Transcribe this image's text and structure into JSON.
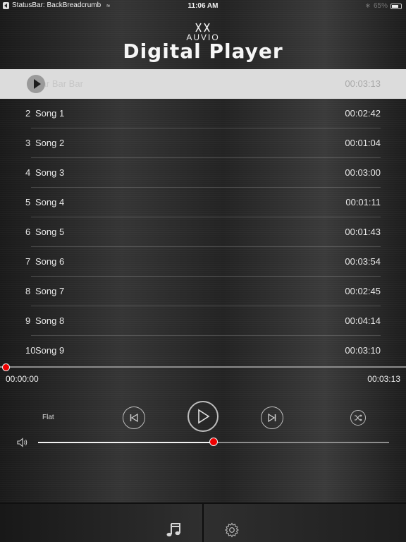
{
  "status_bar": {
    "back_label": "StatusBar: BackBreadcrumb",
    "time": "11:06 AM",
    "battery": "65%"
  },
  "header": {
    "logo_text": "AUVIO",
    "title": "Digital Player"
  },
  "playlist": {
    "now_playing": {
      "name": "Bar Bar Bar",
      "duration": "00:03:13"
    },
    "items": [
      {
        "num": "2",
        "name": "Song 1",
        "duration": "00:02:42"
      },
      {
        "num": "3",
        "name": "Song 2",
        "duration": "00:01:04"
      },
      {
        "num": "4",
        "name": "Song 3",
        "duration": "00:03:00"
      },
      {
        "num": "5",
        "name": "Song 4",
        "duration": "00:01:11"
      },
      {
        "num": "6",
        "name": "Song 5",
        "duration": "00:01:43"
      },
      {
        "num": "7",
        "name": "Song 6",
        "duration": "00:03:54"
      },
      {
        "num": "8",
        "name": "Song 7",
        "duration": "00:02:45"
      },
      {
        "num": "9",
        "name": "Song 8",
        "duration": "00:04:14"
      },
      {
        "num": "10",
        "name": "Song 9",
        "duration": "00:03:10"
      }
    ]
  },
  "player": {
    "elapsed": "00:00:00",
    "total": "00:03:13",
    "progress_fraction": 0,
    "eq_preset": "Flat",
    "volume_fraction": 0.5,
    "icons": {
      "prev": "skip-previous-icon",
      "play": "play-icon",
      "next": "skip-next-icon",
      "shuffle": "shuffle-icon",
      "volume": "volume-icon"
    }
  },
  "tabbar": {
    "tabs": [
      {
        "icon": "music-note-icon"
      },
      {
        "icon": "gear-icon"
      }
    ]
  },
  "colors": {
    "accent": "#e00000",
    "selected_row": "#dcdcdc"
  }
}
